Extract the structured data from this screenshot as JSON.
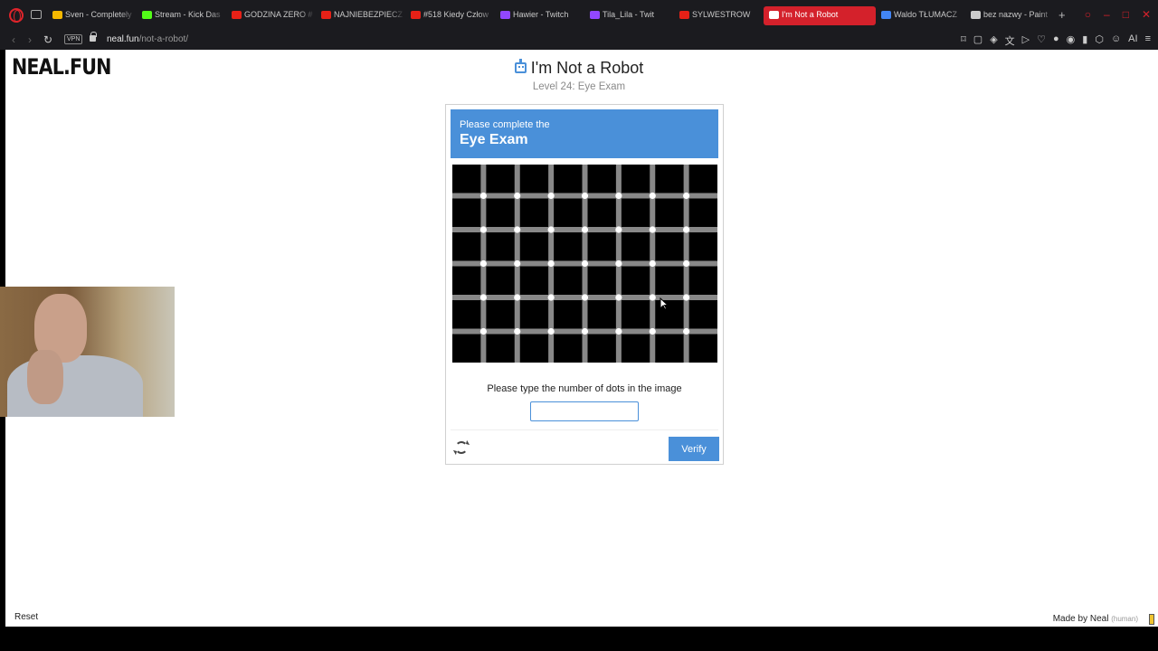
{
  "browser": {
    "tabs": [
      {
        "label": "Sven - Completely",
        "fav_color": "#f5b800"
      },
      {
        "label": "Stream - Kick Das",
        "fav_color": "#53fc18"
      },
      {
        "label": "GODZINA ZERO #",
        "fav_color": "#e62117"
      },
      {
        "label": "NAJNIEBEZPIECZ",
        "fav_color": "#e62117"
      },
      {
        "label": "#518 Kiedy Człow",
        "fav_color": "#e62117"
      },
      {
        "label": "Hawier - Twitch",
        "fav_color": "#9147ff"
      },
      {
        "label": "Tila_Lila - Twit",
        "fav_color": "#9147ff"
      },
      {
        "label": "SYLWESTROW",
        "fav_color": "#e62117"
      },
      {
        "label": "I'm Not a Robot",
        "fav_color": "#ffffff",
        "active": true
      },
      {
        "label": "Waldo TŁUMACZ",
        "fav_color": "#4285f4"
      },
      {
        "label": "bez nazwy - Paint",
        "fav_color": "#cccccc"
      }
    ],
    "vpn_label": "VPN",
    "url_host": "neal.fun",
    "url_path": "/not-a-robot/"
  },
  "page": {
    "brand": "NEAL.FUN",
    "title": "I'm Not a Robot",
    "subtitle": "Level 24: Eye Exam",
    "reset_label": "Reset",
    "made_by": "Made by Neal",
    "made_by_note": "(human)"
  },
  "captcha": {
    "header_small": "Please complete the",
    "header_big": "Eye Exam",
    "instruction": "Please type the number of dots in the image",
    "answer_value": "",
    "verify_label": "Verify",
    "grid": {
      "columns": 8,
      "rows": 6,
      "square_color": "#000000",
      "line_color": "#888888",
      "dot_color": "#ffffff"
    }
  },
  "colors": {
    "accent": "#4a90d9",
    "browser_red": "#d4212b"
  }
}
